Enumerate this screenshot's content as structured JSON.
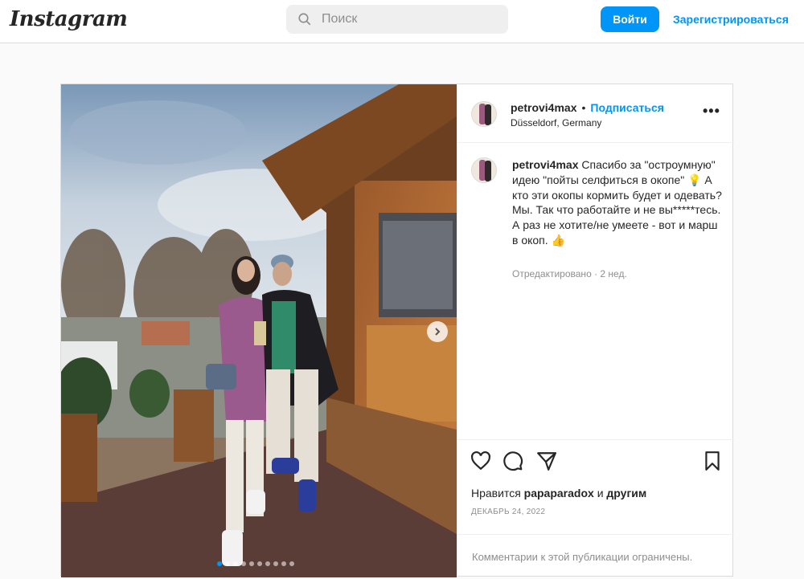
{
  "header": {
    "logo": "Instagram",
    "search_placeholder": "Поиск",
    "login_label": "Войти",
    "register_label": "Зарегистрироваться"
  },
  "post": {
    "author": "petrovi4max",
    "follow_label": "Подписаться",
    "location": "Düsseldorf, Germany",
    "more_label": "•••",
    "caption_user": "petrovi4max",
    "caption_text": "Спасибо за \"остроумную\" идею \"пойты селфиться в окопе\" 💡 А кто эти окопы кормить будет и одевать? Мы. Так что работайте и не вы*****тесь. А раз не хотите/не умеете - вот и марш в окоп. 👍",
    "caption_meta": "Отредактировано · 2 нед.",
    "likes_prefix": "Нравится",
    "likes_user": "papaparadox",
    "likes_and": "и",
    "likes_others": "другим",
    "date": "ДЕКАБРЬ 24, 2022",
    "comments_limited": "Комментарии к этой публикации ограничены.",
    "carousel_count": 10,
    "carousel_active_index": 0
  },
  "icons": {
    "search": "search-icon",
    "like": "heart-icon",
    "comment": "comment-icon",
    "share": "paper-plane-icon",
    "save": "bookmark-icon",
    "next": "chevron-right-icon"
  },
  "colors": {
    "accent": "#0095f6",
    "text": "#262626",
    "muted": "#8e8e8e",
    "border": "#dbdbdb",
    "background": "#fafafa"
  }
}
